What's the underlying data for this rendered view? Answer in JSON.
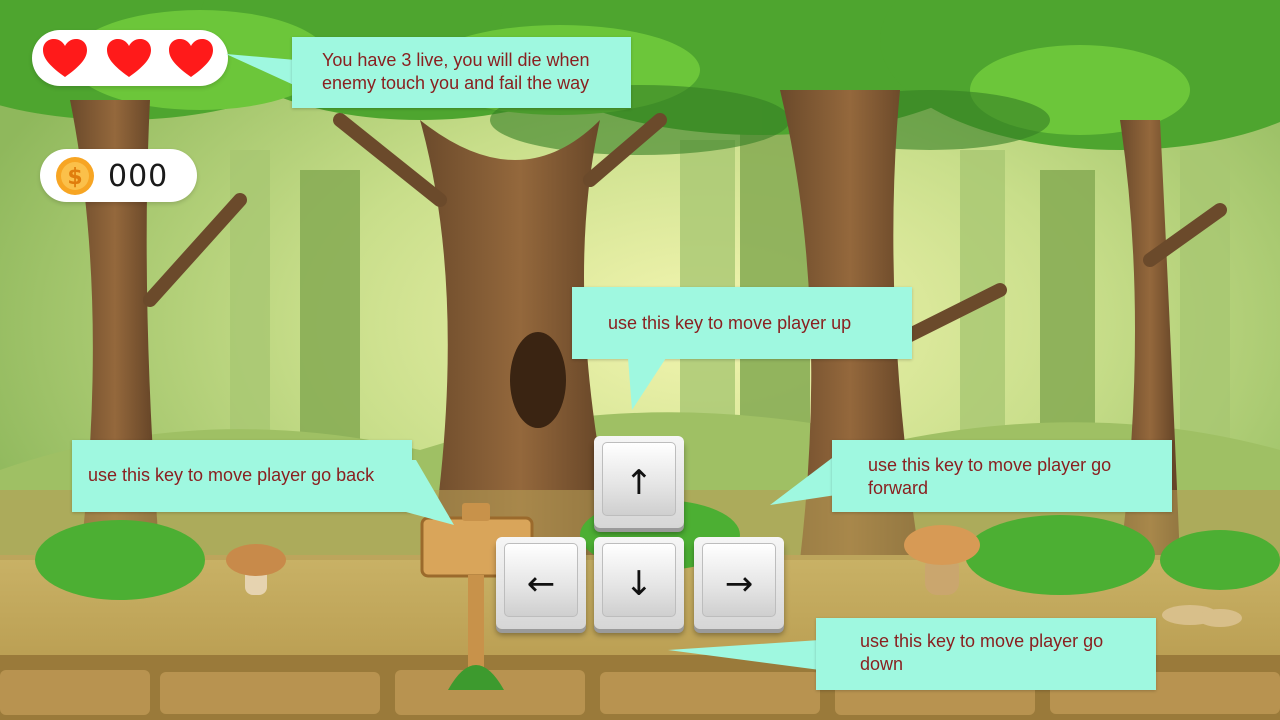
{
  "hud": {
    "lives": 3,
    "hearts": [
      "heart-icon",
      "heart-icon",
      "heart-icon"
    ],
    "coin_count": "000",
    "coin_icon": "dollar-coin-icon"
  },
  "tips": {
    "lives": "You have 3 live, you will die when enemy touch you and fail the way",
    "up": "use this key to move player up",
    "back": "use this key to move player go back",
    "forward": "use this key to move player go forward",
    "down": "use this key to move player go down"
  },
  "keys": {
    "up": "↑",
    "left": "←",
    "down": "↓",
    "right": "→"
  },
  "colors": {
    "heart": "#ff1a1a",
    "tip_background": "#9ff8e0",
    "tip_text": "#8a2020",
    "coin": "#f7a523"
  }
}
